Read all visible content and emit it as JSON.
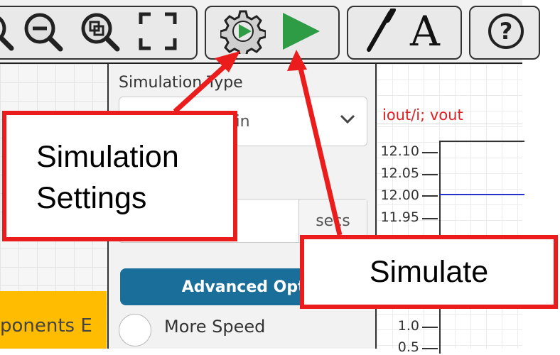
{
  "toolbar": {
    "buttons": [
      {
        "name": "zoom-out",
        "icon": "zoom-out-icon"
      },
      {
        "name": "zoom-fit",
        "icon": "zoom-fit-icon"
      },
      {
        "name": "fullscreen",
        "icon": "fullscreen-icon"
      },
      {
        "name": "simulation-settings",
        "icon": "gear-play-icon"
      },
      {
        "name": "simulate",
        "icon": "play-icon"
      },
      {
        "name": "wire",
        "icon": "pen-icon"
      },
      {
        "name": "text",
        "icon": "text-icon",
        "glyph": "A"
      },
      {
        "name": "help",
        "icon": "help-icon",
        "glyph": "?"
      }
    ]
  },
  "settings": {
    "sim_type_label": "Simulation Type",
    "sim_type_value": "ain",
    "time_unit": "secs",
    "advanced_label": "Advanced Optio",
    "more_speed_label": "More Speed"
  },
  "left": {
    "components_label": "ponents E"
  },
  "plot": {
    "title": "iout/i; vout",
    "ticks": [
      "12.10",
      "12.05",
      "12.00",
      "11.95",
      "1.0",
      "0.5"
    ],
    "trace_color": "#2233cc"
  },
  "annotations": {
    "settings_line1": "Simulation",
    "settings_line2": "Settings",
    "simulate": "Simulate",
    "color": "#ea1c1c"
  }
}
